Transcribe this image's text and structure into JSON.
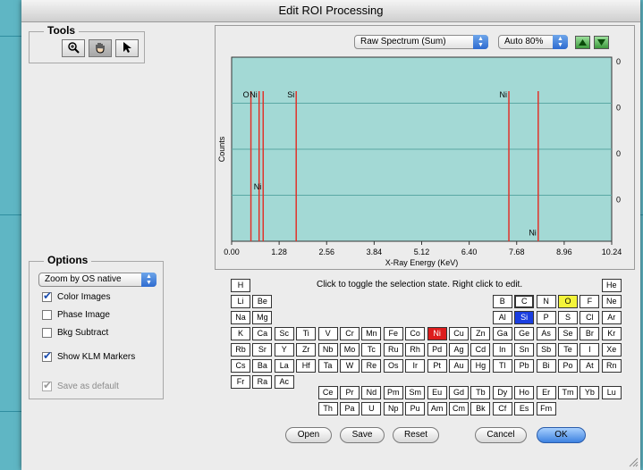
{
  "window": {
    "title": "Edit ROI Processing"
  },
  "tools": {
    "legend": "Tools",
    "items": [
      {
        "icon": "zoom-in-icon",
        "active": false
      },
      {
        "icon": "hand-icon",
        "active": true
      },
      {
        "icon": "arrow-pointer-icon",
        "active": false
      }
    ]
  },
  "options": {
    "legend": "Options",
    "zoom_select": "Zoom by OS native",
    "checkboxes": [
      {
        "label": "Color Images",
        "checked": true,
        "enabled": true
      },
      {
        "label": "Phase Image",
        "checked": false,
        "enabled": true
      },
      {
        "label": "Bkg Subtract",
        "checked": false,
        "enabled": true
      },
      {
        "label": "Show KLM Markers",
        "checked": true,
        "enabled": true
      },
      {
        "label": "Save as default",
        "checked": true,
        "enabled": false
      }
    ]
  },
  "spectrum_controls": {
    "source_select": "Raw Spectrum (Sum)",
    "scale_select": "Auto 80%",
    "up_icon": "triangle-up-icon",
    "down_icon": "triangle-down-icon"
  },
  "chart_data": {
    "type": "line",
    "xlabel": "X-Ray Energy (KeV)",
    "ylabel": "Counts",
    "xlim": [
      0,
      10.24
    ],
    "x_ticks": [
      "0.00",
      "1.28",
      "2.56",
      "3.84",
      "5.12",
      "6.40",
      "7.68",
      "8.96",
      "10.24"
    ],
    "y_tick_labels": [
      "0",
      "0",
      "0",
      "0"
    ],
    "grid": true,
    "background": "#a3d9d5",
    "marker_color": "#e0322a",
    "markers": [
      {
        "label": "O",
        "energy": 0.52,
        "label_row": 0
      },
      {
        "label": "Ni",
        "energy": 0.74,
        "label_row": 0
      },
      {
        "label": "Ni",
        "energy": 0.85,
        "label_row": 2
      },
      {
        "label": "Si",
        "energy": 1.74,
        "label_row": 0
      },
      {
        "label": "Ni",
        "energy": 7.47,
        "label_row": 0
      },
      {
        "label": "Ni",
        "energy": 8.26,
        "label_row": 3
      }
    ]
  },
  "periodic_table": {
    "hint": "Click to toggle the selection state. Right click to edit.",
    "colors": {
      "selected_red": "#dd1c1c",
      "selected_blue": "#1a3ee0",
      "selected_yellow": "#f4f43a"
    },
    "elements": [
      {
        "s": "H",
        "r": 0,
        "c": 0
      },
      {
        "s": "He",
        "r": 0,
        "c": 17
      },
      {
        "s": "Li",
        "r": 1,
        "c": 0
      },
      {
        "s": "Be",
        "r": 1,
        "c": 1
      },
      {
        "s": "B",
        "r": 1,
        "c": 12
      },
      {
        "s": "C",
        "r": 1,
        "c": 13,
        "state": "outline"
      },
      {
        "s": "N",
        "r": 1,
        "c": 14
      },
      {
        "s": "O",
        "r": 1,
        "c": 15,
        "state": "yellow"
      },
      {
        "s": "F",
        "r": 1,
        "c": 16
      },
      {
        "s": "Ne",
        "r": 1,
        "c": 17
      },
      {
        "s": "Na",
        "r": 2,
        "c": 0
      },
      {
        "s": "Mg",
        "r": 2,
        "c": 1
      },
      {
        "s": "Al",
        "r": 2,
        "c": 12
      },
      {
        "s": "Si",
        "r": 2,
        "c": 13,
        "state": "blue"
      },
      {
        "s": "P",
        "r": 2,
        "c": 14
      },
      {
        "s": "S",
        "r": 2,
        "c": 15
      },
      {
        "s": "Cl",
        "r": 2,
        "c": 16
      },
      {
        "s": "Ar",
        "r": 2,
        "c": 17
      },
      {
        "s": "K",
        "r": 3,
        "c": 0
      },
      {
        "s": "Ca",
        "r": 3,
        "c": 1
      },
      {
        "s": "Sc",
        "r": 3,
        "c": 2
      },
      {
        "s": "Ti",
        "r": 3,
        "c": 3
      },
      {
        "s": "V",
        "r": 3,
        "c": 4
      },
      {
        "s": "Cr",
        "r": 3,
        "c": 5
      },
      {
        "s": "Mn",
        "r": 3,
        "c": 6
      },
      {
        "s": "Fe",
        "r": 3,
        "c": 7
      },
      {
        "s": "Co",
        "r": 3,
        "c": 8
      },
      {
        "s": "Ni",
        "r": 3,
        "c": 9,
        "state": "red"
      },
      {
        "s": "Cu",
        "r": 3,
        "c": 10
      },
      {
        "s": "Zn",
        "r": 3,
        "c": 11
      },
      {
        "s": "Ga",
        "r": 3,
        "c": 12
      },
      {
        "s": "Ge",
        "r": 3,
        "c": 13
      },
      {
        "s": "As",
        "r": 3,
        "c": 14
      },
      {
        "s": "Se",
        "r": 3,
        "c": 15
      },
      {
        "s": "Br",
        "r": 3,
        "c": 16
      },
      {
        "s": "Kr",
        "r": 3,
        "c": 17
      },
      {
        "s": "Rb",
        "r": 4,
        "c": 0
      },
      {
        "s": "Sr",
        "r": 4,
        "c": 1
      },
      {
        "s": "Y",
        "r": 4,
        "c": 2
      },
      {
        "s": "Zr",
        "r": 4,
        "c": 3
      },
      {
        "s": "Nb",
        "r": 4,
        "c": 4
      },
      {
        "s": "Mo",
        "r": 4,
        "c": 5
      },
      {
        "s": "Tc",
        "r": 4,
        "c": 6
      },
      {
        "s": "Ru",
        "r": 4,
        "c": 7
      },
      {
        "s": "Rh",
        "r": 4,
        "c": 8
      },
      {
        "s": "Pd",
        "r": 4,
        "c": 9
      },
      {
        "s": "Ag",
        "r": 4,
        "c": 10
      },
      {
        "s": "Cd",
        "r": 4,
        "c": 11
      },
      {
        "s": "In",
        "r": 4,
        "c": 12
      },
      {
        "s": "Sn",
        "r": 4,
        "c": 13
      },
      {
        "s": "Sb",
        "r": 4,
        "c": 14
      },
      {
        "s": "Te",
        "r": 4,
        "c": 15
      },
      {
        "s": "I",
        "r": 4,
        "c": 16
      },
      {
        "s": "Xe",
        "r": 4,
        "c": 17
      },
      {
        "s": "Cs",
        "r": 5,
        "c": 0
      },
      {
        "s": "Ba",
        "r": 5,
        "c": 1
      },
      {
        "s": "La",
        "r": 5,
        "c": 2
      },
      {
        "s": "Hf",
        "r": 5,
        "c": 3
      },
      {
        "s": "Ta",
        "r": 5,
        "c": 4
      },
      {
        "s": "W",
        "r": 5,
        "c": 5
      },
      {
        "s": "Re",
        "r": 5,
        "c": 6
      },
      {
        "s": "Os",
        "r": 5,
        "c": 7
      },
      {
        "s": "Ir",
        "r": 5,
        "c": 8
      },
      {
        "s": "Pt",
        "r": 5,
        "c": 9
      },
      {
        "s": "Au",
        "r": 5,
        "c": 10
      },
      {
        "s": "Hg",
        "r": 5,
        "c": 11
      },
      {
        "s": "Tl",
        "r": 5,
        "c": 12
      },
      {
        "s": "Pb",
        "r": 5,
        "c": 13
      },
      {
        "s": "Bi",
        "r": 5,
        "c": 14
      },
      {
        "s": "Po",
        "r": 5,
        "c": 15
      },
      {
        "s": "At",
        "r": 5,
        "c": 16
      },
      {
        "s": "Rn",
        "r": 5,
        "c": 17
      },
      {
        "s": "Fr",
        "r": 6,
        "c": 0
      },
      {
        "s": "Ra",
        "r": 6,
        "c": 1
      },
      {
        "s": "Ac",
        "r": 6,
        "c": 2
      },
      {
        "s": "Ce",
        "r": 7,
        "c": 4
      },
      {
        "s": "Pr",
        "r": 7,
        "c": 5
      },
      {
        "s": "Nd",
        "r": 7,
        "c": 6
      },
      {
        "s": "Pm",
        "r": 7,
        "c": 7
      },
      {
        "s": "Sm",
        "r": 7,
        "c": 8
      },
      {
        "s": "Eu",
        "r": 7,
        "c": 9
      },
      {
        "s": "Gd",
        "r": 7,
        "c": 10
      },
      {
        "s": "Tb",
        "r": 7,
        "c": 11
      },
      {
        "s": "Dy",
        "r": 7,
        "c": 12
      },
      {
        "s": "Ho",
        "r": 7,
        "c": 13
      },
      {
        "s": "Er",
        "r": 7,
        "c": 14
      },
      {
        "s": "Tm",
        "r": 7,
        "c": 15
      },
      {
        "s": "Yb",
        "r": 7,
        "c": 16
      },
      {
        "s": "Lu",
        "r": 7,
        "c": 17
      },
      {
        "s": "Th",
        "r": 8,
        "c": 4
      },
      {
        "s": "Pa",
        "r": 8,
        "c": 5
      },
      {
        "s": "U",
        "r": 8,
        "c": 6
      },
      {
        "s": "Np",
        "r": 8,
        "c": 7
      },
      {
        "s": "Pu",
        "r": 8,
        "c": 8
      },
      {
        "s": "Am",
        "r": 8,
        "c": 9
      },
      {
        "s": "Cm",
        "r": 8,
        "c": 10
      },
      {
        "s": "Bk",
        "r": 8,
        "c": 11
      },
      {
        "s": "Cf",
        "r": 8,
        "c": 12
      },
      {
        "s": "Es",
        "r": 8,
        "c": 13
      },
      {
        "s": "Fm",
        "r": 8,
        "c": 14
      }
    ]
  },
  "buttons": {
    "open": "Open",
    "save": "Save",
    "reset": "Reset",
    "cancel": "Cancel",
    "ok": "OK"
  }
}
